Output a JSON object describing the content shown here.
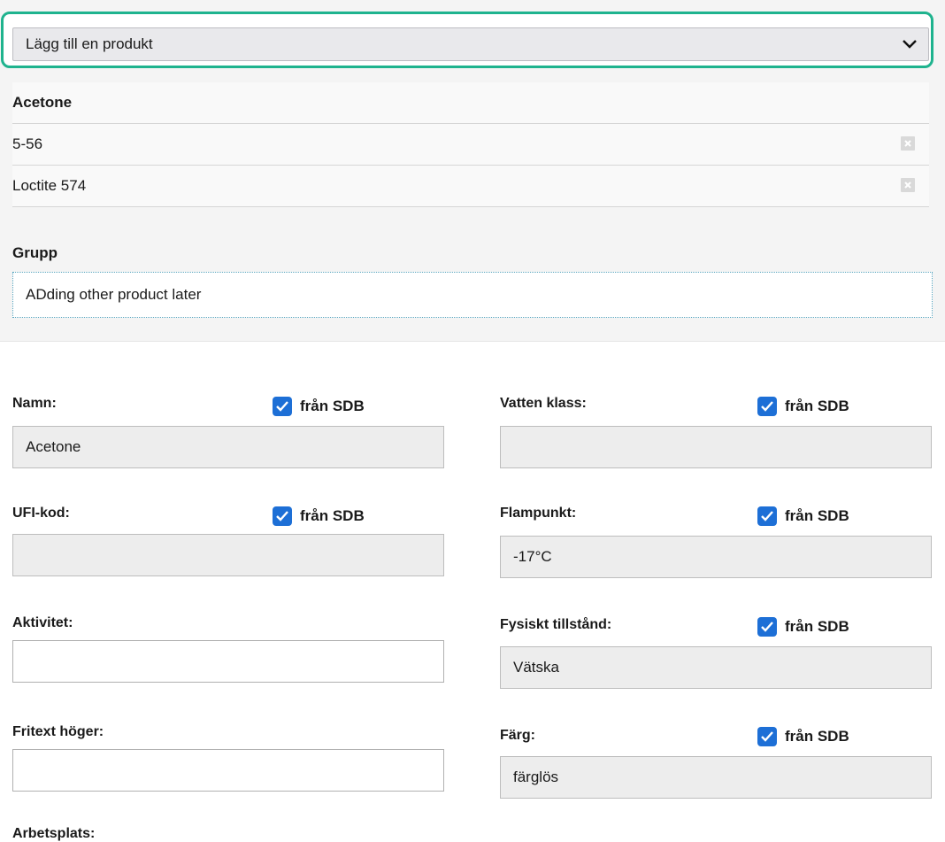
{
  "product_select": {
    "label": "Lägg till en produkt",
    "icon": "chevron-down-icon"
  },
  "products": {
    "header": "Acetone",
    "items": [
      {
        "name": "5-56"
      },
      {
        "name": "Loctite 574"
      }
    ]
  },
  "group": {
    "label": "Grupp",
    "value": "ADding other product later"
  },
  "sdb_label": "från SDB",
  "fields": {
    "namn": {
      "label": "Namn:",
      "value": "Acetone"
    },
    "vatten_klass": {
      "label": "Vatten klass:",
      "value": ""
    },
    "ufi_kod": {
      "label": "UFI-kod:",
      "value": ""
    },
    "flampunkt": {
      "label": "Flampunkt:",
      "value": "-17°C"
    },
    "aktivitet": {
      "label": "Aktivitet:",
      "value": ""
    },
    "fysiskt_tillstand": {
      "label": "Fysiskt tillstånd:",
      "value": "Vätska"
    },
    "fritext_hoger": {
      "label": "Fritext höger:",
      "value": ""
    },
    "farg": {
      "label": "Färg:",
      "value": "färglös"
    }
  },
  "cut_off_label": "Arbetsplats:",
  "colors": {
    "highlight": "#1fb38e",
    "checkbox": "#1d6fd6"
  }
}
